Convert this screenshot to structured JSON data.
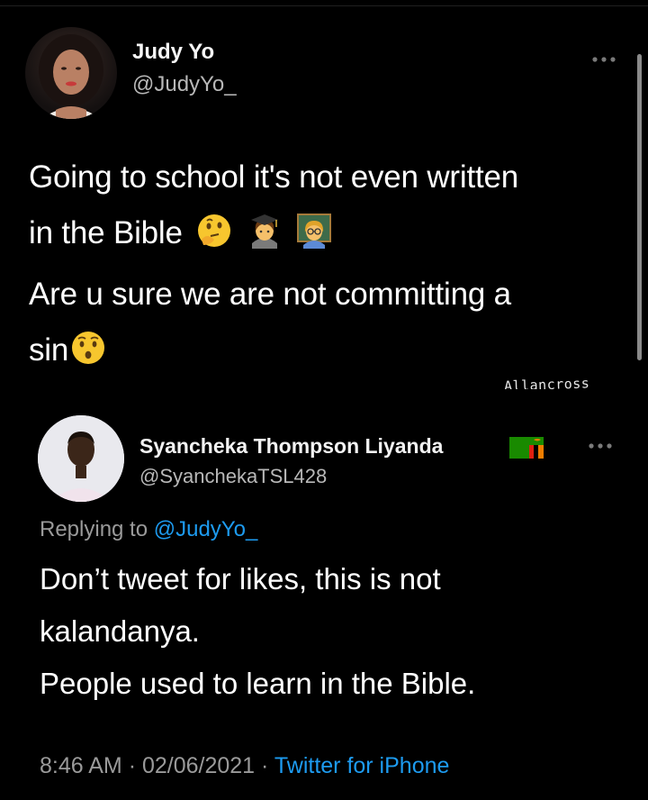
{
  "tweet": {
    "author_name": "Judy Yo",
    "author_handle": "@JudyYo_",
    "text_line1": "Going to school it's not even written",
    "text_line2": "in the Bible",
    "text_line3": "Are u sure we are not committing a",
    "text_line4": "sin",
    "emojis_line2": [
      "thinking-face-emoji",
      "student-emoji",
      "teacher-emoji"
    ],
    "emojis_line4": [
      "hushed-face-emoji"
    ],
    "more_icon": "ellipsis-icon"
  },
  "watermark": "Allancross",
  "reply": {
    "author_name": "Syancheka Thompson Liyanda",
    "flag_icon": "zambia-flag-icon",
    "author_handle": "@SyanchekaTSL428",
    "replying_prefix": "Replying to",
    "replying_mention": "@JudyYo_",
    "text_line1": "Don’t tweet for likes, this is not",
    "text_line2": "kalandanya.",
    "text_line3": "People used to learn in the Bible.",
    "time": "8:46 AM",
    "separator": "·",
    "date": "02/06/2021",
    "source": "Twitter for iPhone",
    "more_icon": "ellipsis-icon"
  },
  "colors": {
    "background": "#000000",
    "link": "#1d9bf0",
    "secondary_text": "#9a9a9a"
  }
}
